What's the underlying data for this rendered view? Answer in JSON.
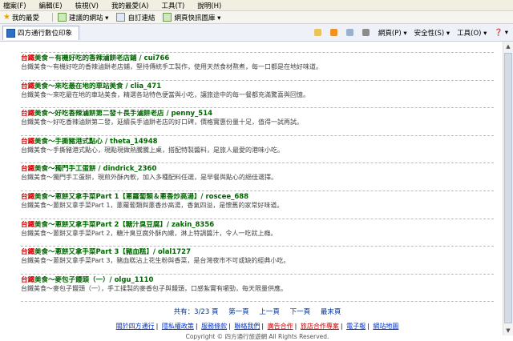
{
  "menu": [
    "檔案(F)",
    "編輯(E)",
    "檢視(V)",
    "我的最愛(A)",
    "工具(T)",
    "說明(H)"
  ],
  "favorites": {
    "label": "我的最愛",
    "items": [
      "建議的網站 ▾",
      "自訂連結",
      "網頁快訊圖庫 ▾"
    ]
  },
  "tab": {
    "title": "四方通行數位印象"
  },
  "tools": [
    "網頁(P) ▾",
    "安全性(S) ▾",
    "工具(O) ▾",
    "❓ ▾"
  ],
  "results": [
    {
      "title_pre": "",
      "title_hl": "",
      "title_post": "",
      "snippet": ""
    },
    {
      "title_pre": "",
      "title_hl": "台鐵",
      "title_post": "美食－有機好吃的香辣滷餅老店鋪 / cui766",
      "snippet": "台鐵美食～有機好吃的香辣滷餅老店鋪，堅持傳統手工製作，使用天然食材熬煮，每一口都是在地好味道。"
    },
    {
      "title_pre": "",
      "title_hl": "台鐵",
      "title_post": "美食～來吃最在地的車站美食 / clia_471",
      "snippet": "台鐵美食～來吃最在地的車站美食，精選各站特色便當與小吃，讓旅途中的每一餐都充滿驚喜與回憶。"
    },
    {
      "title_pre": "",
      "title_hl": "台鐵",
      "title_post": "美食～好吃香辣滷餅第二發＋長手滷餅老店 / penny_514",
      "snippet": "台鐵美食～好吃香辣滷餅第二發，延續長手滷餅老店的好口碑，價格實惠份量十足，值得一試再試。"
    },
    {
      "title_pre": "",
      "title_hl": "台鐵",
      "title_post": "美食～手撕豬港式點心 / theta_14948",
      "snippet": "台鐵美食～手撕豬港式點心，現點現做熱騰騰上桌，搭配特製醬料，是旅人最愛的港味小吃。"
    },
    {
      "title_pre": "",
      "title_hl": "台鐵",
      "title_post": "美食～獨門手工蛋餅 / dindrick_2360",
      "snippet": "台鐵美食～獨門手工蛋餅，現煎外酥內軟，加入多種配料任選，是早餐與點心的絕佳選擇。"
    },
    {
      "title_pre": "",
      "title_hl": "台鐵",
      "title_post": "美食～蔥餅又拿手菜Part 1【蔥蘿蔔類＆蔥香炒高湯】/ roscee_688",
      "snippet": "台鐵美食～蔥餅又拿手菜Part 1，蔥蘿蔔類與蔥香炒高湯，香氣四溢，是懷舊的家常好味道。"
    },
    {
      "title_pre": "",
      "title_hl": "台鐵",
      "title_post": "美食～蔥餅又拿手菜Part 2【糖汁臭豆腐】/ zakin_8356",
      "snippet": "台鐵美食～蔥餅又拿手菜Part 2，糖汁臭豆腐外酥內嫩，淋上特調醬汁，令人一吃就上癮。"
    },
    {
      "title_pre": "",
      "title_hl": "台鐵",
      "title_post": "美食～蔥餅又拿手菜Part 3【豬血糕】/ olal1727",
      "snippet": "台鐵美食～蔥餅又拿手菜Part 3，豬血糕沾上花生粉與香菜，是台灣夜市不可或缺的經典小吃。"
    },
    {
      "title_pre": "",
      "title_hl": "台鐵",
      "title_post": "美食～麥包子饅頭（一）/ olgu_1110",
      "snippet": "台鐵美食～麥包子饅頭（一），手工揉製的麥香包子與饅頭，口感紮實有嚼勁，每天限量供應。"
    }
  ],
  "pager": [
    "共有：3/23 頁",
    "第一頁",
    "上一頁",
    "下一頁",
    "最末頁"
  ],
  "footer": {
    "links": [
      "關於四方通行",
      "隱私權政策",
      "服務條款",
      "聯絡我們",
      "廣告合作",
      "旅店合作專案",
      "電子報",
      "網站地圖"
    ],
    "copyright": "Copyright © 四方通行旅遊網 All Rights Reserved."
  },
  "colors": {
    "link_green": "#006600",
    "highlight_red": "#d40000"
  }
}
